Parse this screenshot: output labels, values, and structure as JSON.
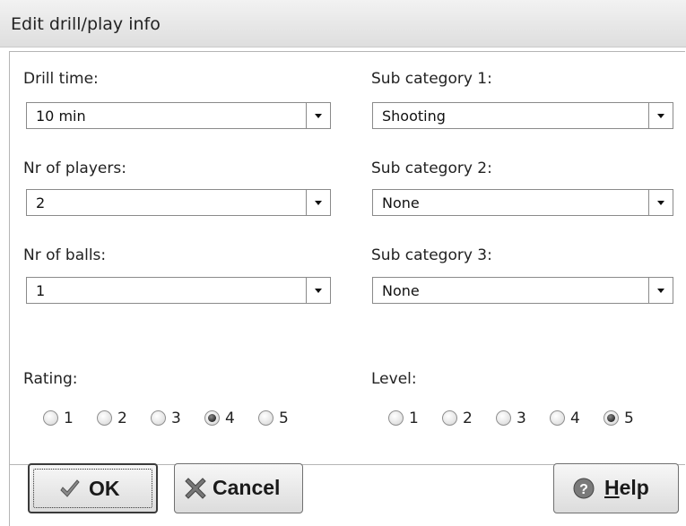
{
  "window": {
    "title": "Edit drill/play info"
  },
  "fields": {
    "drill_time": {
      "label": "Drill time:",
      "value": "10 min"
    },
    "nr_players": {
      "label": "Nr of players:",
      "value": "2"
    },
    "nr_balls": {
      "label": "Nr of balls:",
      "value": "1"
    },
    "sub_cat_1": {
      "label": "Sub category 1:",
      "value": "Shooting"
    },
    "sub_cat_2": {
      "label": "Sub category 2:",
      "value": "None"
    },
    "sub_cat_3": {
      "label": "Sub category 3:",
      "value": "None"
    }
  },
  "rating": {
    "label": "Rating:",
    "options": [
      "1",
      "2",
      "3",
      "4",
      "5"
    ],
    "selected": "4"
  },
  "level": {
    "label": "Level:",
    "options": [
      "1",
      "2",
      "3",
      "4",
      "5"
    ],
    "selected": "5"
  },
  "buttons": {
    "ok": {
      "label": "OK",
      "icon": "checkmark-icon"
    },
    "cancel": {
      "label": "Cancel",
      "icon": "cross-icon"
    },
    "help": {
      "label_underlined": "H",
      "label_rest": "elp",
      "icon": "help-icon"
    }
  },
  "colors": {
    "titlebar": "#e6e6e6",
    "border": "#b5b5b5"
  }
}
